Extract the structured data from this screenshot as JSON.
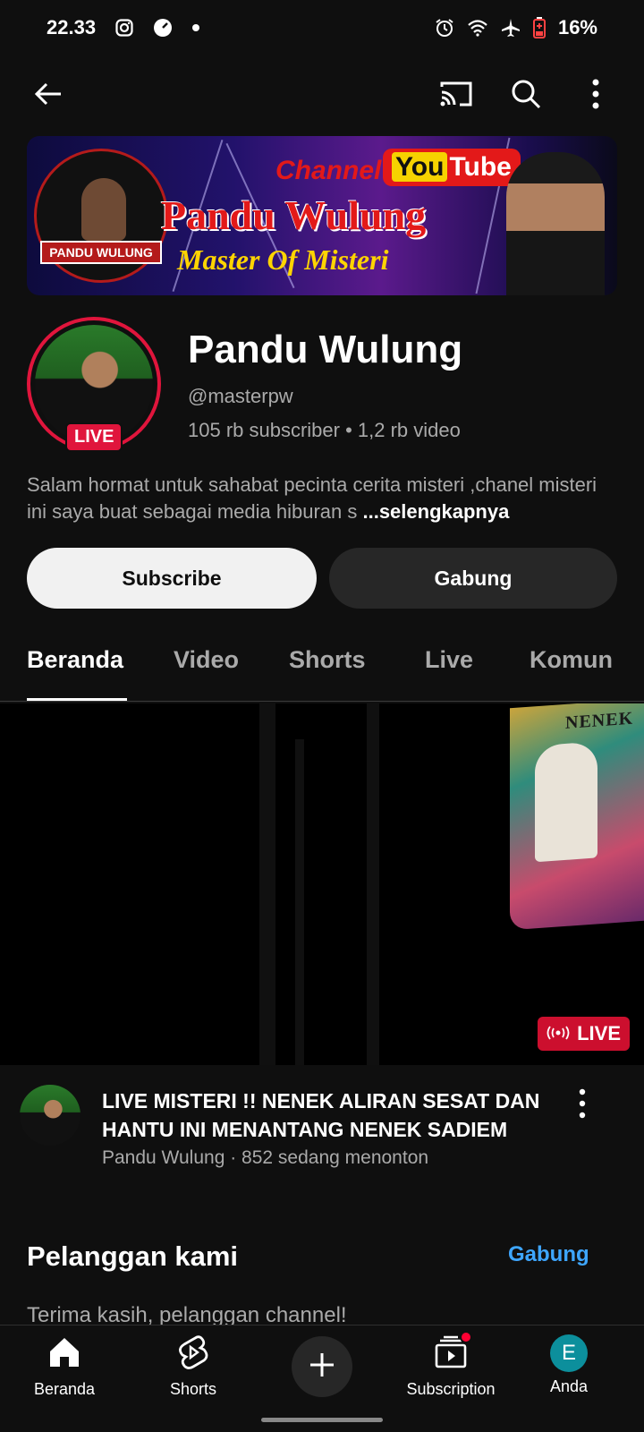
{
  "status_bar": {
    "time": "22.33",
    "battery": "16%",
    "icons": [
      "instagram-icon",
      "speedometer-icon",
      "dot-icon",
      "alarm-icon",
      "wifi-icon",
      "airplane-icon",
      "battery-low-icon"
    ]
  },
  "app_bar": {
    "icons": [
      "back-arrow-icon",
      "cast-icon",
      "search-icon",
      "more-vert-icon"
    ]
  },
  "banner": {
    "channel_word": "Channel",
    "youtube_you": "You",
    "youtube_tube": "Tube",
    "name": "Pandu Wulung",
    "tagline": "Master Of Misteri",
    "logo_text": "PANDU WULUNG"
  },
  "channel": {
    "name": "Pandu Wulung",
    "handle": "@masterpw",
    "stats": "105 rb subscriber • 1,2 rb video",
    "live_badge": "LIVE",
    "description": "Salam hormat untuk  sahabat pecinta cerita misteri ,chanel misteri  ini saya buat sebagai media hiburan s",
    "more_label": "...selengkapnya"
  },
  "actions": {
    "subscribe": "Subscribe",
    "join": "Gabung"
  },
  "tabs": [
    {
      "label": "Beranda",
      "active": true
    },
    {
      "label": "Video"
    },
    {
      "label": "Shorts"
    },
    {
      "label": "Live"
    },
    {
      "label": "Komun"
    }
  ],
  "video": {
    "poster_title": "NENEK",
    "live_label": "LIVE",
    "title": "LIVE MISTERI !! NENEK ALIRAN SESAT DAN HANTU INI  MENANTANG NENEK SADIEM",
    "subtitle": "Pandu Wulung · 852 sedang menonton"
  },
  "members": {
    "title": "Pelanggan kami",
    "join": "Gabung",
    "text": "Terima kasih, pelanggan channel!"
  },
  "bottom_nav": [
    {
      "label": "Beranda",
      "icon": "home-icon"
    },
    {
      "label": "Shorts",
      "icon": "shorts-icon"
    },
    {
      "label": "",
      "icon": "create-plus-icon"
    },
    {
      "label": "Subscription",
      "icon": "subscriptions-icon"
    },
    {
      "label": "Anda",
      "icon": "account-avatar",
      "initial": "E"
    }
  ],
  "colors": {
    "background": "#0f0f0f",
    "live_red": "#e0153c",
    "link_blue": "#3ea6ff",
    "avatar_teal": "#0c8f9c"
  }
}
